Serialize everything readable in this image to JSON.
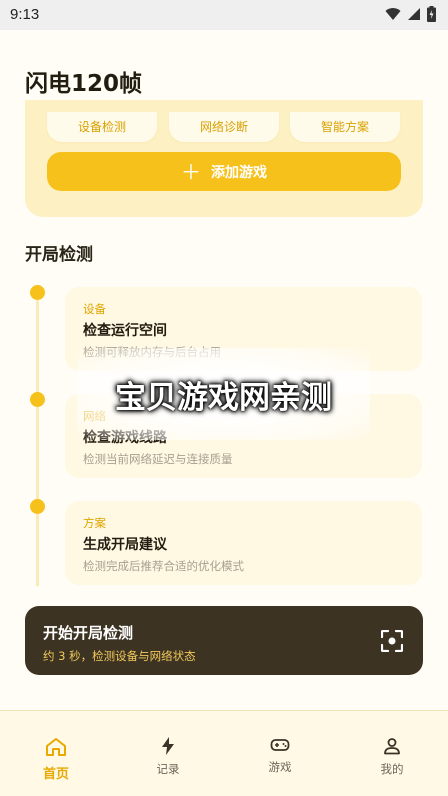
{
  "status": {
    "time": "9:13"
  },
  "app": {
    "title": "闪电120帧"
  },
  "quick_actions": [
    {
      "label": "设备检测"
    },
    {
      "label": "网络诊断"
    },
    {
      "label": "智能方案"
    }
  ],
  "add_game": {
    "icon": "plus-icon",
    "label": "添加游戏"
  },
  "section": {
    "title": "开局检测"
  },
  "steps": [
    {
      "tag": "设备",
      "title": "检查运行空间",
      "desc": "检测可释放内存与后台占用"
    },
    {
      "tag": "网络",
      "title": "检查游戏线路",
      "desc": "检测当前网络延迟与连接质量"
    },
    {
      "tag": "方案",
      "title": "生成开局建议",
      "desc": "检测完成后推荐合适的优化模式"
    }
  ],
  "start": {
    "title": "开始开局检测",
    "subtitle": "约 3 秒，检测设备与网络状态",
    "icon": "scan-icon"
  },
  "watermark": "宝贝游戏网亲测",
  "nav": [
    {
      "label": "首页",
      "icon": "home-icon",
      "active": true
    },
    {
      "label": "记录",
      "icon": "lightning-icon",
      "active": false
    },
    {
      "label": "游戏",
      "icon": "gamepad-icon",
      "active": false
    },
    {
      "label": "我的",
      "icon": "user-icon",
      "active": false
    }
  ],
  "colors": {
    "accent": "#F7C11B",
    "dark_card": "#3C3323",
    "hero_bg": "#FDF0C3"
  }
}
